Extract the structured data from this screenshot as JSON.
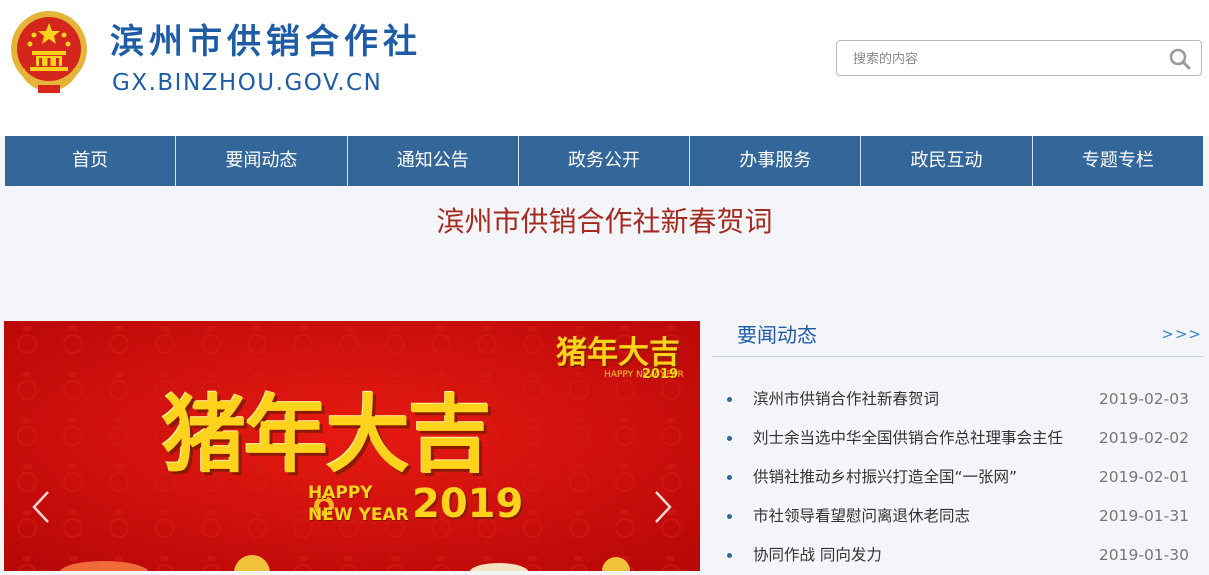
{
  "header": {
    "site_title": "滨州市供销合作社",
    "site_domain": "GX.BINZHOU.GOV.CN",
    "search_placeholder": "搜索的内容"
  },
  "nav": {
    "items": [
      {
        "label": "首页"
      },
      {
        "label": "要闻动态"
      },
      {
        "label": "通知公告"
      },
      {
        "label": "政务公开"
      },
      {
        "label": "办事服务"
      },
      {
        "label": "政民互动"
      },
      {
        "label": "专题专栏"
      }
    ]
  },
  "headline": "滨州市供销合作社新春贺词",
  "banner": {
    "main_text": "猪年大吉",
    "corner_text": "猪年大吉",
    "corner_sub": "HAPPY NEW YEAR",
    "corner_year": "2019",
    "happy": "HAPPY",
    "new_year": "NEW YEAR",
    "year": "2019"
  },
  "news": {
    "title": "要闻动态",
    "more": ">>>",
    "items": [
      {
        "title": "滨州市供销合作社新春贺词",
        "date": "2019-02-03"
      },
      {
        "title": "刘士余当选中华全国供销合作总社理事会主任",
        "date": "2019-02-02"
      },
      {
        "title": "供销社推动乡村振兴打造全国“一张网”",
        "date": "2019-02-01"
      },
      {
        "title": "市社领导看望慰问离退休老同志",
        "date": "2019-01-31"
      },
      {
        "title": "协同作战 同向发力",
        "date": "2019-01-30"
      }
    ]
  },
  "colors": {
    "brand_blue": "#1f5ca6",
    "nav_blue": "#336699",
    "headline_red": "#a52a22",
    "banner_red": "#c81010",
    "banner_gold": "#ffd21c"
  }
}
